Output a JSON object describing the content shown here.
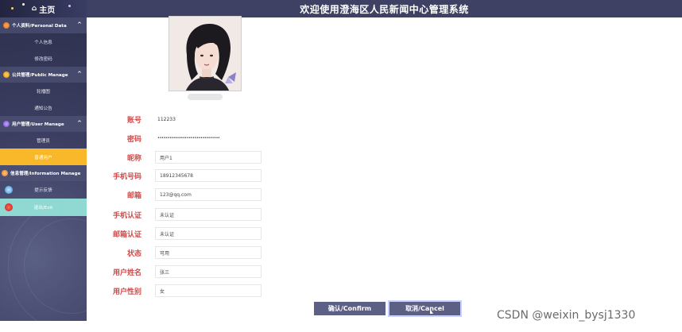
{
  "sidebar": {
    "home_label": "主页",
    "groups": [
      {
        "title": "个人资料/Personal Data",
        "icon": "atom-icon",
        "items": [
          "个人信息",
          "修改密码"
        ]
      },
      {
        "title": "公共管理/Public Manage",
        "icon": "orb-icon",
        "items": [
          "轮播图",
          "通知公告"
        ]
      },
      {
        "title": "用户管理/User Manage",
        "icon": "crystal-icon",
        "items": [
          "管理员",
          "普通用户"
        ],
        "active_item": 1
      }
    ],
    "rows": [
      {
        "label": "信息管理/Information Manage",
        "icon": "planet-icon"
      },
      {
        "label": "提示反馈",
        "icon": "globe-icon"
      },
      {
        "label": "退出/Exit",
        "icon": "red-ball-icon"
      }
    ]
  },
  "header": {
    "title": "欢迎使用澄海区人民新闻中心管理系统"
  },
  "form": {
    "account_label": "账号",
    "account_value": "112233",
    "password_label": "密码",
    "password_value": "••••••••••••••••••••••••••••••••",
    "nickname_label": "昵称",
    "nickname_value": "用户1",
    "phone_label": "手机号码",
    "phone_value": "18912345678",
    "email_label": "邮箱",
    "email_value": "123@qq.com",
    "phone_verify_label": "手机认证",
    "phone_verify_value": "未认证",
    "email_verify_label": "邮箱认证",
    "email_verify_value": "未认证",
    "status_label": "状态",
    "status_value": "可用",
    "name_label": "用户姓名",
    "name_value": "张三",
    "gender_label": "用户性别",
    "gender_value": "女"
  },
  "buttons": {
    "confirm": "确认/Confirm",
    "cancel": "取消/Cancel"
  },
  "watermark": "CSDN @weixin_bysj1330",
  "colors": {
    "header": "#3e4163",
    "active": "#f8b82a",
    "exit": "#8fd9d2",
    "label": "#d24a4a",
    "button": "#5d6085"
  }
}
